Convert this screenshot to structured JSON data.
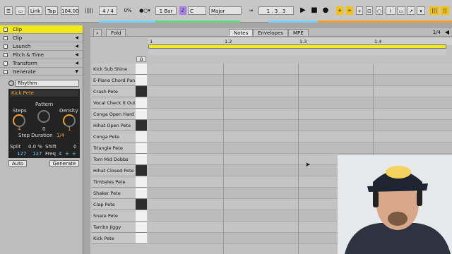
{
  "transport": {
    "link": "Link",
    "tap": "Tap",
    "tempo": "104.00",
    "time_sig": "4 / 4",
    "cpu": "0%",
    "quant": "1 Bar",
    "key": "C",
    "scale": "Major",
    "position": "1 .  3 .  3"
  },
  "sidebar": {
    "items": [
      {
        "label": "Clip",
        "active": true
      },
      {
        "label": "Clip"
      },
      {
        "label": "Launch"
      },
      {
        "label": "Pitch & Time"
      },
      {
        "label": "Transform"
      },
      {
        "label": "Generate"
      }
    ]
  },
  "generate": {
    "mode": "Rhythm",
    "target": "Kick Pete",
    "pattern_label": "Pattern",
    "steps_label": "Steps",
    "density_label": "Density",
    "steps_value": "4",
    "pattern_value": "0",
    "density_value": "1",
    "step_duration_label": "Step Duration",
    "step_duration_value": "1/4",
    "split_label": "Split",
    "split_value": "0.0 %",
    "shift_label": "Shift",
    "shift_value": "0",
    "v1": "127",
    "v2": "127",
    "freq_label": "Freq",
    "freq_value": "4",
    "auto": "Auto",
    "generate": "Generate"
  },
  "editor": {
    "fold": "Fold",
    "tabs": [
      "Notes",
      "Envelopes",
      "MPE"
    ],
    "page": "1/4",
    "ruler": [
      "1",
      "1.2",
      "1.3",
      "1.4"
    ],
    "rows": [
      "Kick Sub Shine",
      "E-Piano Chord Pan",
      "Crash Pete",
      "Vocal Check It Out",
      "Conga Open Hard",
      "Hihat Open Pete",
      "Conga Pete",
      "Triangle Pete",
      "Tom Mid Dobbs",
      "Hihat Closed Pete",
      "Timbales Pete",
      "Shaker Pete",
      "Clap Pete",
      "Snare Pete",
      "Tambo Jiggy",
      "Kick Pete"
    ]
  },
  "colors": {
    "accent": "#f2e91a",
    "orange": "#f2a22a",
    "panel": "#232323"
  }
}
